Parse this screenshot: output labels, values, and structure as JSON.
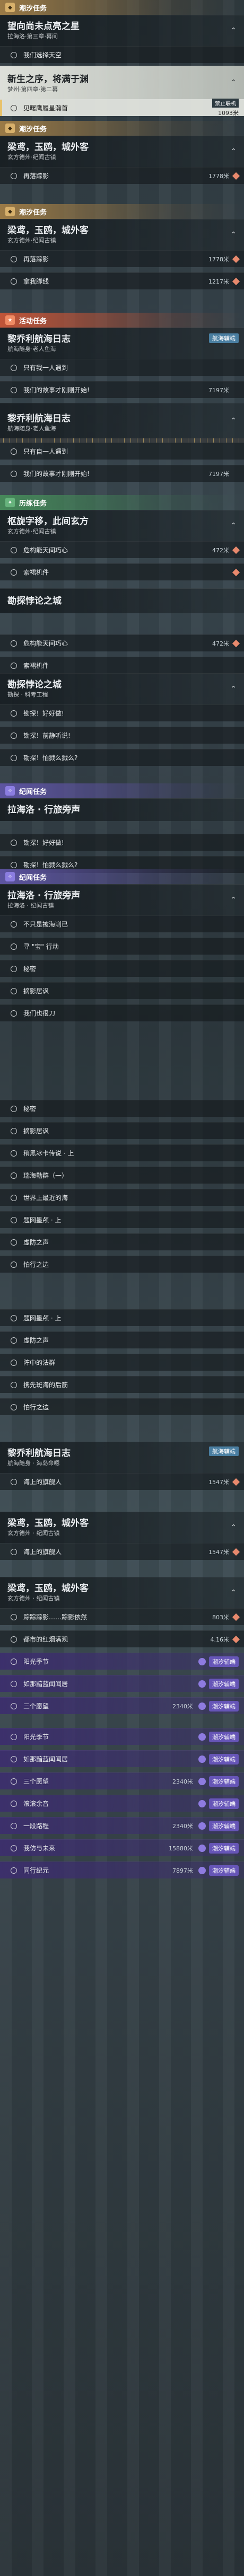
{
  "labels": {
    "tide": "潮汐任务",
    "event": "活动任务",
    "trial": "历练任务",
    "legend": "纪闻任务",
    "no_map": "禁止联机",
    "waves": "潮汐辅端",
    "navigate": "航海辅端"
  },
  "s1": {
    "c1": {
      "title": "望向尚未点亮之星",
      "sub": "拉海洛·第三章·幕间"
    },
    "r1": "我们选择天空"
  },
  "s2": {
    "c1": {
      "title": "新生之序，将满于渊",
      "sub": "梦州·第四章·第二幕"
    },
    "r1": {
      "text": "见曙鹰履星瀚首",
      "dist": "1093米"
    }
  },
  "s3": {
    "c1": {
      "title": "梁鸢，玉鸥，城外客",
      "sub": "玄方德州·纪闻古镇"
    },
    "r1": {
      "text": "再落踪影",
      "dist": "1778米"
    }
  },
  "s4": {
    "c1": {
      "title": "梁鸢，玉鸥，城外客",
      "sub": "玄方德州·纪闻古镇"
    },
    "r1": {
      "text": "再落踪影",
      "dist": "1778米"
    },
    "r2": {
      "text": "拿我脚线",
      "dist": "1217米"
    }
  },
  "s5": {
    "c1": {
      "title": "黎乔利航海日志",
      "sub": "航海随身·老人鱼海"
    },
    "r1": "只有我一人遇到",
    "r2": "我们的故事才刚刚开始!",
    "dist": "7197米"
  },
  "s6": {
    "c1": {
      "title": "黎乔利航海日志",
      "sub": "航海随身·老人鱼海"
    },
    "r1": "只有自一人遇到",
    "r2": {
      "text": "我们的故事才刚刚开始!",
      "dist": "7197米"
    }
  },
  "s7": {
    "c1": {
      "title": "枢旋字移，此间玄方",
      "sub": "玄方德州·纪闻古镇"
    },
    "r1": {
      "text": "危构能天间巧心",
      "dist": "472米"
    },
    "r2": "索裙机件"
  },
  "s8": {
    "c1": {
      "title": "勘探悖论之城",
      "sub": ""
    },
    "r1": {
      "text": "危构能天间巧心",
      "dist": "472米"
    },
    "r2": "索裙机件"
  },
  "s9": {
    "c1": {
      "title": "勘探悖论之城",
      "sub": "勘探 · 科考工程"
    },
    "r1": "勘探！好好做!",
    "r2": "勘探！前静听说!",
    "r3": "勘探！怕戮么戮么?"
  },
  "s10": {
    "c1": {
      "title": "拉海洛 · 行旅旁声",
      "sub": ""
    },
    "r1": "勘探！好好做!",
    "r2": "勘探！怕戮么戮么?"
  },
  "s11": {
    "c1": {
      "title": "拉海洛 · 行旅旁声",
      "sub": "拉海洛 · 纪闻古镇"
    },
    "rows": [
      "不只是被海削已",
      "寻 \"宝\" 行动",
      "秘密",
      "摘影居讽",
      "我们也很刀"
    ]
  },
  "s12": {
    "rows": [
      "秘密",
      "摘影居讽",
      "稍黑冰卡传说 · 上",
      "瑞海勤群（一）",
      "世界上最近的海",
      "题网墨颅 · 上",
      "虚防之声",
      "怕行之边"
    ]
  },
  "s13": {
    "rows": [
      "题网墨颅 · 上",
      "虚防之声",
      "阵中的法群",
      "携先斑海的后筋",
      "怕行之边"
    ]
  },
  "s14": {
    "c1": {
      "title": "黎乔利航海日志",
      "sub": "航海随身 · 海岛命嗯"
    },
    "r1": {
      "text": "海上的旗舰人",
      "dist": "1547米"
    }
  },
  "s15": {
    "c1": {
      "title": "梁鸢，玉鸥，城外客",
      "sub": "玄方德州 · 纪闻古镇"
    },
    "r1": {
      "text": "海上的旗舰人",
      "dist": "1547米"
    }
  },
  "s16": {
    "c1": {
      "title": "梁鸢，玉鸥，城外客",
      "sub": "玄方德州 · 纪闻古镇"
    },
    "rows": [
      {
        "text": "踪踪踪影……踪影依然",
        "dist": "803米"
      },
      {
        "text": "都市的红烟满观",
        "dist": "4.16米"
      },
      {
        "text": "阳光季节",
        "dist": "",
        "badge": true
      },
      {
        "text": "如那黯蓝闻闻居",
        "dist": "",
        "badge": true
      },
      {
        "text": "三个愿望",
        "dist": "2340米",
        "badge": true
      }
    ]
  },
  "s17": {
    "rows": [
      {
        "text": "阳光季节",
        "dist": "",
        "badge": true
      },
      {
        "text": "如那黯蓝闻闻居",
        "dist": "",
        "badge": true
      },
      {
        "text": "三个愿望",
        "dist": "2340米",
        "badge": true
      },
      {
        "text": "滚滚余音",
        "dist": "",
        "badge": true
      },
      {
        "text": "一段路程",
        "dist": "2340米",
        "badge": true
      },
      {
        "text": "我仿与未来",
        "dist": "15880米",
        "badge": true
      },
      {
        "text": "同行纪元",
        "dist": "7897米",
        "badge": true
      }
    ]
  }
}
